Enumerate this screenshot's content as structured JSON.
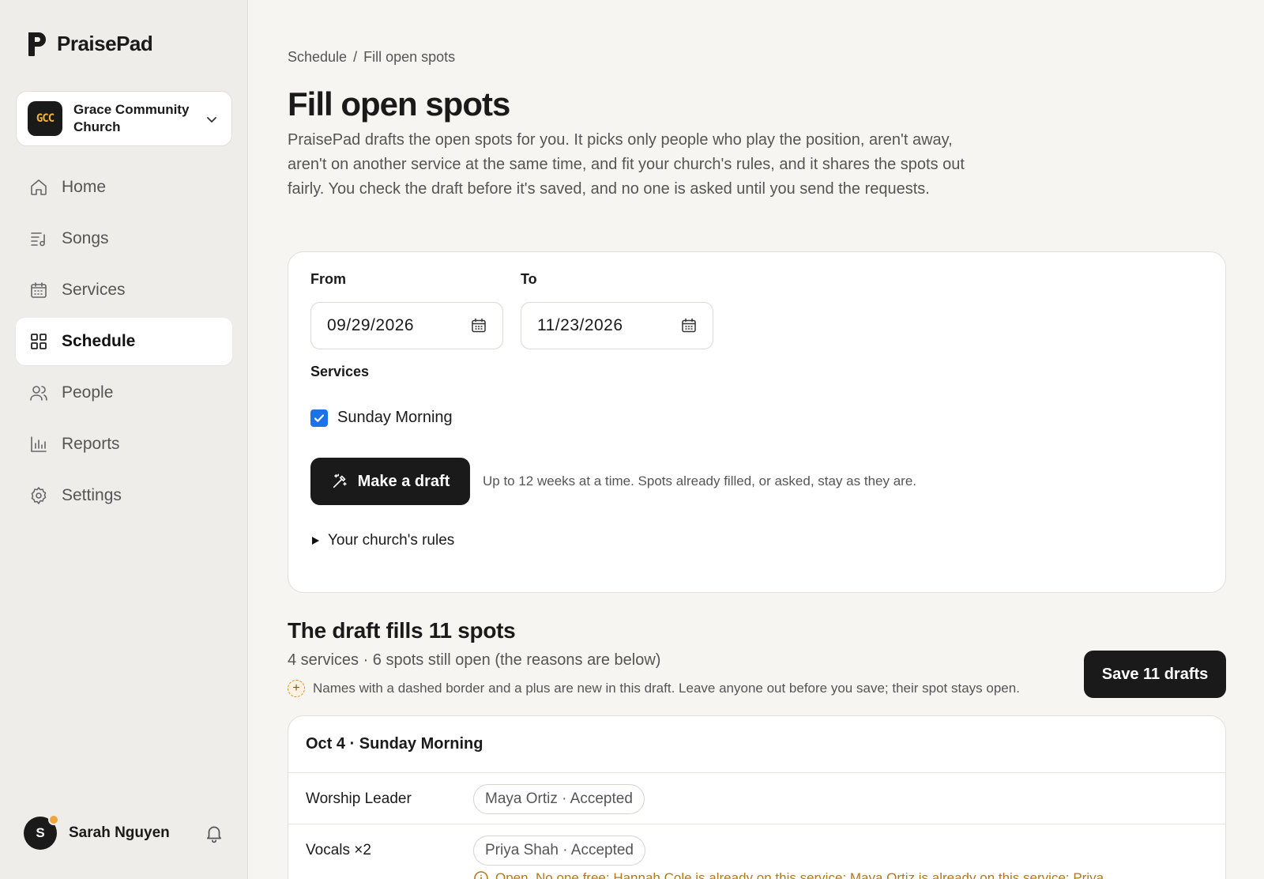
{
  "brand": {
    "name": "PraisePad"
  },
  "org": {
    "initials": "GCC",
    "name": "Grace Community Church"
  },
  "nav": [
    {
      "label": "Home",
      "icon": "home-icon"
    },
    {
      "label": "Songs",
      "icon": "songs-icon"
    },
    {
      "label": "Services",
      "icon": "calendar-icon"
    },
    {
      "label": "Schedule",
      "icon": "grid-icon",
      "active": true
    },
    {
      "label": "People",
      "icon": "people-icon"
    },
    {
      "label": "Reports",
      "icon": "bar-chart-icon"
    },
    {
      "label": "Settings",
      "icon": "gear-icon"
    }
  ],
  "user": {
    "initial": "S",
    "name": "Sarah Nguyen"
  },
  "breadcrumb": {
    "parent": "Schedule",
    "separator": "/",
    "current": "Fill open spots"
  },
  "page": {
    "title": "Fill open spots",
    "intro": "PraisePad drafts the open spots for you. It picks only people who play the position, aren't away, aren't on another service at the same time, and fit your church's rules, and it shares the spots out fairly. You check the draft before it's saved, and no one is asked until you send the requests."
  },
  "form": {
    "from_label": "From",
    "from_value": "09/29/2026",
    "to_label": "To",
    "to_value": "11/23/2026",
    "services_label": "Services",
    "service_option": "Sunday Morning",
    "service_checked": true,
    "draft_button": "Make a draft",
    "draft_hint": "Up to 12 weeks at a time. Spots already filled, or asked, stay as they are.",
    "rules_toggle": "Your church's rules"
  },
  "draft": {
    "title": "The draft fills 11 spots",
    "summary": "4 services · 6 spots still open (the reasons are below)",
    "legend": "Names with a dashed border and a plus are new in this draft. Leave anyone out before you save; their spot stays open.",
    "save_button": "Save 11 drafts"
  },
  "service": {
    "heading": "Oct 4 · Sunday Morning",
    "positions": [
      {
        "name": "Worship Leader",
        "chip": "Maya Ortiz · Accepted"
      },
      {
        "name": "Vocals ×2",
        "chip": "Priya Shah · Accepted"
      }
    ],
    "open_note": "Open. No one free: Hannah Cole is already on this service; Maya Ortiz is already on this service; Priya"
  },
  "colors": {
    "accent": "#1a1a1a",
    "checkbox": "#1a73e8",
    "new_badge": "#d98a2a",
    "warning_text": "#b07a1a"
  }
}
